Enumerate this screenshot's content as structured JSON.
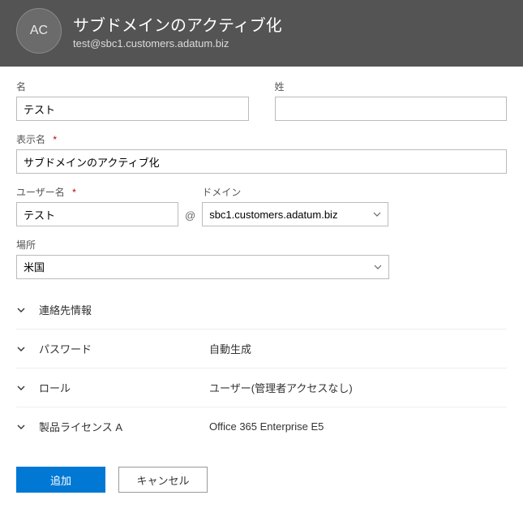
{
  "header": {
    "avatar_initials": "AC",
    "title": "サブドメインのアクティブ化",
    "email": "test@sbc1.customers.adatum.biz"
  },
  "labels": {
    "first_name": "名",
    "last_name": "姓",
    "display_name": "表示名",
    "username": "ユーザー名",
    "domain": "ドメイン",
    "location": "場所"
  },
  "values": {
    "first_name": "テスト",
    "last_name": "",
    "display_name": "サブドメインのアクティブ化",
    "username": "テスト",
    "domain": "sbc1.customers.adatum.biz",
    "location": "米国",
    "at_symbol": "@"
  },
  "sections": {
    "contact": {
      "label": "連絡先情報",
      "value": ""
    },
    "password": {
      "label": "パスワード",
      "value": "自動生成"
    },
    "role": {
      "label": "ロール",
      "value": "ユーザー(管理者アクセスなし)"
    },
    "license": {
      "label": "製品ライセンス A",
      "value": "Office 365 Enterprise E5"
    }
  },
  "buttons": {
    "add": "追加",
    "cancel": "キャンセル"
  },
  "required_marker": "*"
}
